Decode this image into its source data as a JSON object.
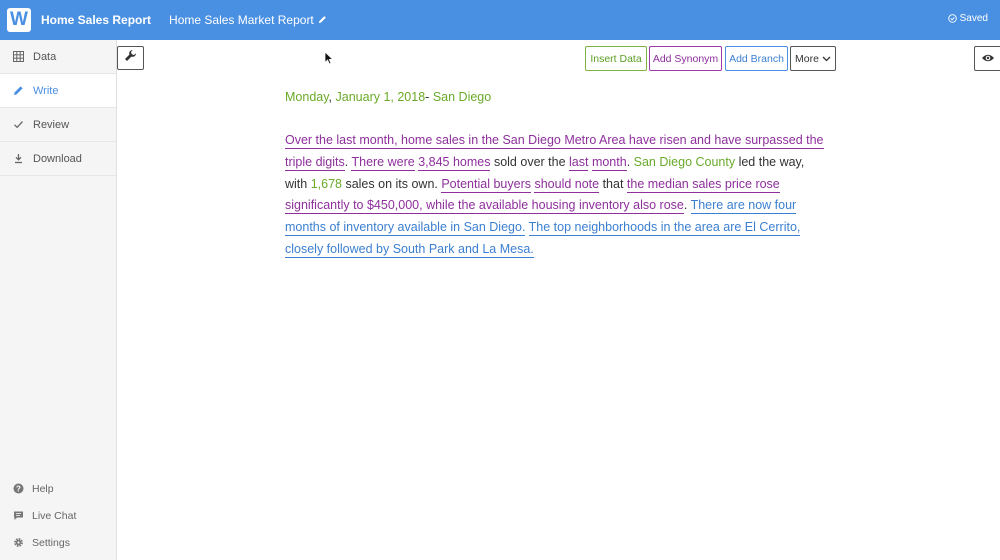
{
  "header": {
    "logo_letter": "W",
    "app_title": "Home Sales Report",
    "doc_title": "Home Sales Market Report",
    "saved_label": "Saved",
    "bg_color": "#4a90e2"
  },
  "sidebar": {
    "items": [
      {
        "label": "Data",
        "icon": "table-grid-icon"
      },
      {
        "label": "Write",
        "icon": "pencil-icon",
        "active": true
      },
      {
        "label": "Review",
        "icon": "check-icon"
      },
      {
        "label": "Download",
        "icon": "download-icon"
      }
    ],
    "bottom_items": [
      {
        "label": "Help",
        "icon": "help-icon"
      },
      {
        "label": "Live Chat",
        "icon": "chat-icon"
      },
      {
        "label": "Settings",
        "icon": "gear-icon"
      }
    ]
  },
  "toolbar": {
    "insert_data_label": "Insert Data",
    "add_synonym_label": "Add Synonym",
    "add_branch_label": "Add Branch",
    "more_label": "More"
  },
  "colors": {
    "data_green": "#6aaa2a",
    "synonym_purple": "#8e2f9c",
    "branch_blue": "#3b7fd0"
  },
  "document": {
    "date_day": "Monday",
    "date_comma": ",",
    "date_rest": "January 1, 2018",
    "date_dash": "-",
    "date_city": "San Diego",
    "segments": [
      {
        "text": "Over the last month, home sales in the San Diego Metro Area have risen and have surpassed the triple digits",
        "style": "v"
      },
      {
        "text": ". ",
        "style": "plain"
      },
      {
        "text": "There were",
        "style": "v"
      },
      {
        "text": " ",
        "style": "plain"
      },
      {
        "text": "3,845 homes",
        "style": "v"
      },
      {
        "text": " sold over the ",
        "style": "plain"
      },
      {
        "text": "last",
        "style": "v"
      },
      {
        "text": " ",
        "style": "plain"
      },
      {
        "text": "month",
        "style": "v"
      },
      {
        "text": ". ",
        "style": "plain"
      },
      {
        "text": "San Diego County",
        "style": "g"
      },
      {
        "text": " led the way, with ",
        "style": "plain"
      },
      {
        "text": "1,678",
        "style": "g"
      },
      {
        "text": " sales on its own. ",
        "style": "plain"
      },
      {
        "text": "Potential buyers",
        "style": "v"
      },
      {
        "text": " ",
        "style": "plain"
      },
      {
        "text": "should note",
        "style": "v"
      },
      {
        "text": " that ",
        "style": "plain"
      },
      {
        "text": "the median sales price rose significantly to $450,000, while the available housing inventory also rose",
        "style": "v"
      },
      {
        "text": ". ",
        "style": "plain"
      },
      {
        "text": "There are now four months of inventory available in San Diego.",
        "style": "b"
      },
      {
        "text": " ",
        "style": "plain"
      },
      {
        "text": "The top neighborhoods in the area are El Cerrito, closely followed by South Park and  La Mesa.",
        "style": "b"
      }
    ]
  }
}
